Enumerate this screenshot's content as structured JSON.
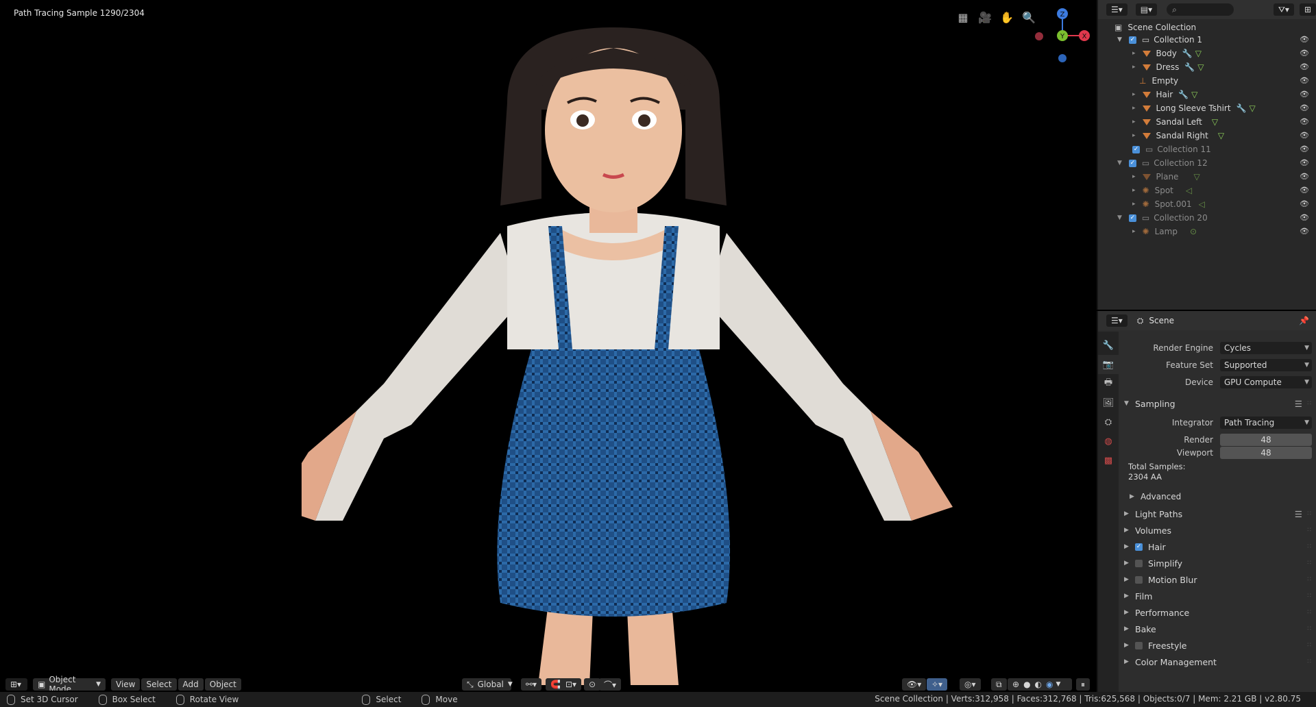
{
  "viewport": {
    "info_text": "Path Tracing Sample 1290/2304",
    "header": {
      "mode": "Object Mode",
      "menus": [
        "View",
        "Select",
        "Add",
        "Object"
      ],
      "transform_orientation": "Global"
    },
    "gizmo": {
      "z": "Z",
      "y": "Y",
      "x": "X"
    }
  },
  "statusbar": {
    "left": [
      "Set 3D Cursor",
      "Box Select",
      "Rotate View"
    ],
    "mid": [
      "Select",
      "Move"
    ],
    "stats": "Scene Collection | Verts:312,958 | Faces:312,768 | Tris:625,568 | Objects:0/7 | Mem: 2.21 GB | v2.80.75"
  },
  "outliner": {
    "root": "Scene Collection",
    "rows": [
      {
        "label": "Collection 1",
        "kind": "collection",
        "dim": false
      },
      {
        "label": "Body",
        "kind": "mesh",
        "dim": false
      },
      {
        "label": "Dress",
        "kind": "mesh",
        "dim": false
      },
      {
        "label": "Empty",
        "kind": "empty",
        "dim": false
      },
      {
        "label": "Hair",
        "kind": "mesh",
        "dim": false
      },
      {
        "label": "Long Sleeve Tshirt",
        "kind": "mesh",
        "dim": false
      },
      {
        "label": "Sandal Left",
        "kind": "mesh",
        "dim": false
      },
      {
        "label": "Sandal Right",
        "kind": "mesh",
        "dim": false
      },
      {
        "label": "Collection 11",
        "kind": "collection",
        "dim": true
      },
      {
        "label": "Collection 12",
        "kind": "collection",
        "dim": true
      },
      {
        "label": "Plane",
        "kind": "mesh",
        "dim": true
      },
      {
        "label": "Spot",
        "kind": "light",
        "dim": true
      },
      {
        "label": "Spot.001",
        "kind": "light",
        "dim": true
      },
      {
        "label": "Collection 20",
        "kind": "collection",
        "dim": true
      },
      {
        "label": "Lamp",
        "kind": "light",
        "dim": true
      }
    ]
  },
  "properties": {
    "context": "Scene",
    "render_engine_label": "Render Engine",
    "render_engine": "Cycles",
    "feature_set_label": "Feature Set",
    "feature_set": "Supported",
    "device_label": "Device",
    "device": "GPU Compute",
    "sampling": {
      "title": "Sampling",
      "integrator_label": "Integrator",
      "integrator": "Path Tracing",
      "render_label": "Render",
      "render": "48",
      "viewport_label": "Viewport",
      "viewport": "48",
      "total_label": "Total Samples:",
      "total_value": "2304 AA",
      "advanced": "Advanced"
    },
    "panels": [
      {
        "label": "Light Paths",
        "checkbox": null
      },
      {
        "label": "Volumes",
        "checkbox": null
      },
      {
        "label": "Hair",
        "checkbox": true
      },
      {
        "label": "Simplify",
        "checkbox": false
      },
      {
        "label": "Motion Blur",
        "checkbox": false
      },
      {
        "label": "Film",
        "checkbox": null
      },
      {
        "label": "Performance",
        "checkbox": null
      },
      {
        "label": "Bake",
        "checkbox": null
      },
      {
        "label": "Freestyle",
        "checkbox": false
      },
      {
        "label": "Color Management",
        "checkbox": null
      }
    ]
  }
}
